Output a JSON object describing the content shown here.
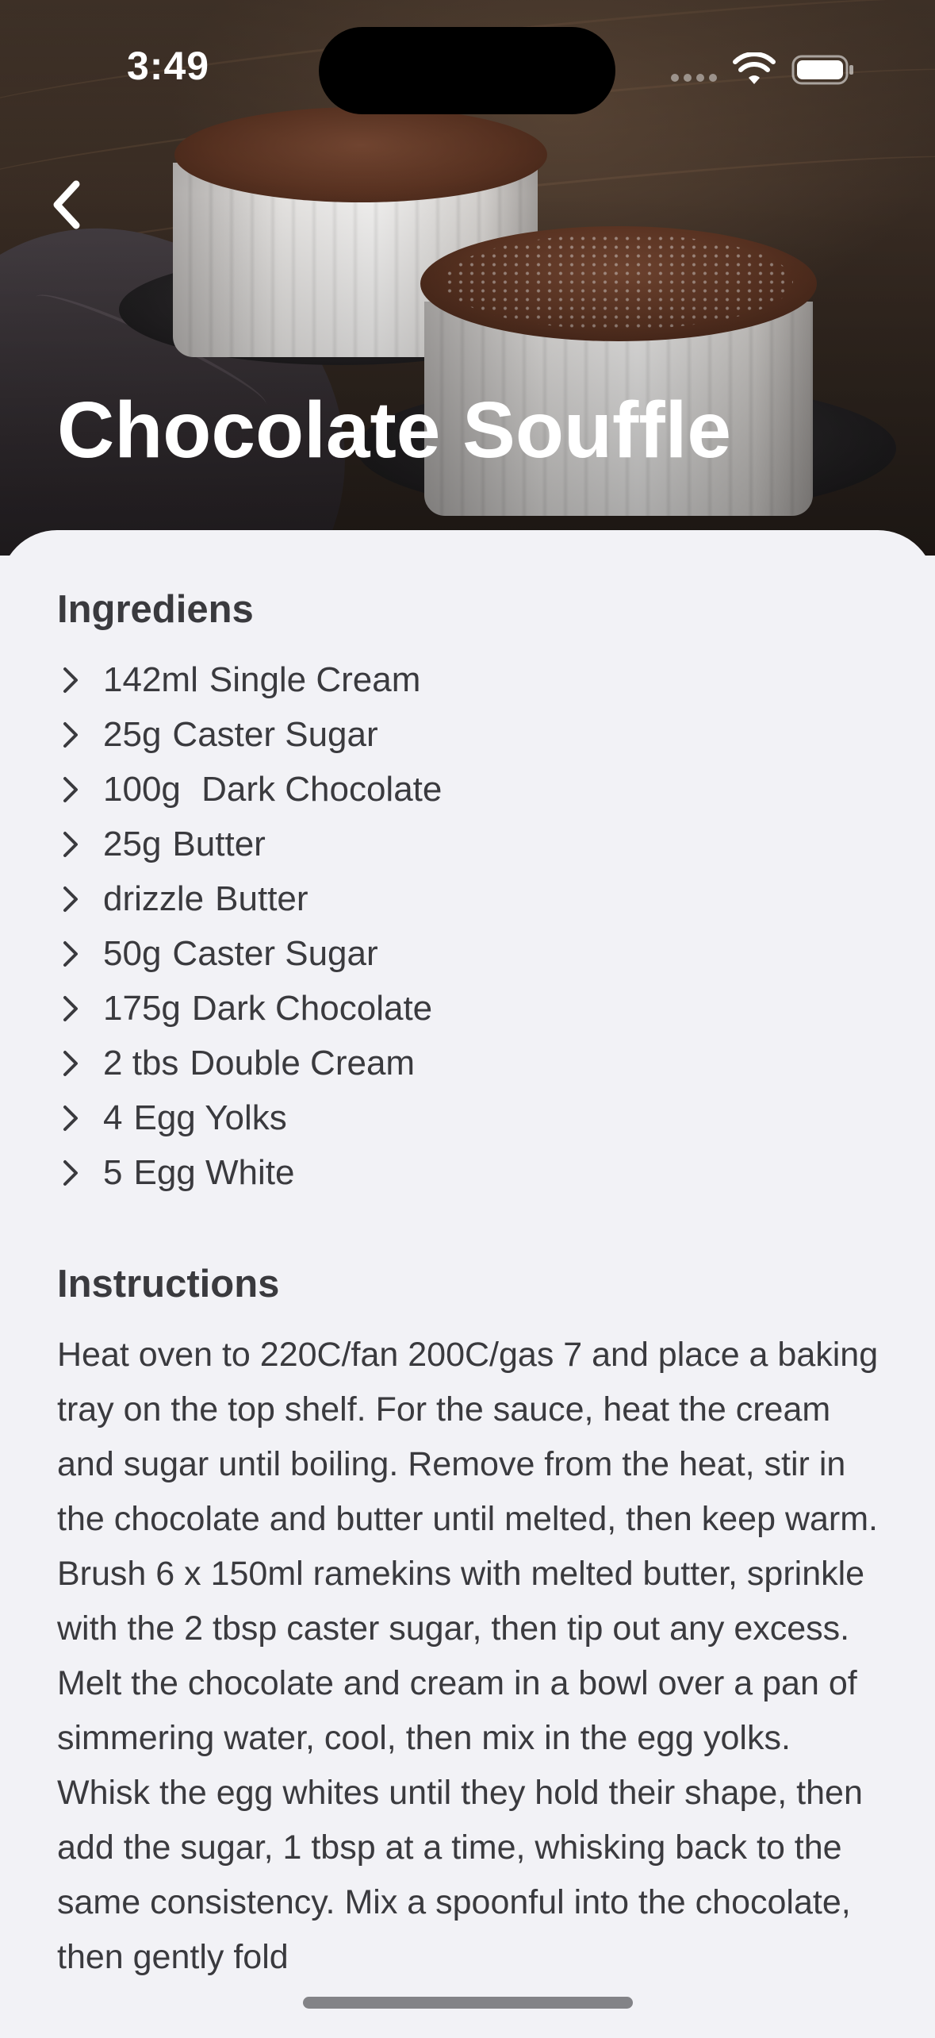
{
  "status_bar": {
    "time": "3:49"
  },
  "navigation": {
    "back_icon": "chevron-left-icon"
  },
  "recipe": {
    "title": "Chocolate Souffle"
  },
  "ingredients": {
    "heading": "Ingrediens",
    "items": [
      {
        "measure": "142ml",
        "name": "Single Cream"
      },
      {
        "measure": "25g",
        "name": "Caster Sugar"
      },
      {
        "measure": "100g ",
        "name": "Dark Chocolate"
      },
      {
        "measure": "25g",
        "name": "Butter"
      },
      {
        "measure": "drizzle",
        "name": "Butter"
      },
      {
        "measure": "50g",
        "name": "Caster Sugar"
      },
      {
        "measure": "175g",
        "name": "Dark Chocolate"
      },
      {
        "measure": "2 tbs",
        "name": "Double Cream"
      },
      {
        "measure": "4",
        "name": "Egg Yolks"
      },
      {
        "measure": "5",
        "name": "Egg White"
      }
    ]
  },
  "instructions": {
    "heading": "Instructions",
    "paragraphs": [
      "Heat oven to 220C/fan 200C/gas 7 and place a baking tray on the top shelf. For the sauce, heat the cream and sugar until boiling. Remove from the heat, stir in the chocolate and butter until melted, then keep warm.",
      "Brush 6 x 150ml ramekins with melted butter, sprinkle with the 2 tbsp caster sugar, then tip out any excess. Melt the chocolate and cream in a bowl over a pan of simmering water, cool, then mix in the egg yolks. Whisk the egg whites until they hold their shape, then add the sugar, 1 tbsp at a time, whisking back to the same consistency. Mix a spoonful into the chocolate, then gently fold"
    ]
  },
  "colors": {
    "sheet_background": "#f2f2f6",
    "text": "#3a3a3e",
    "title": "#ffffff"
  }
}
